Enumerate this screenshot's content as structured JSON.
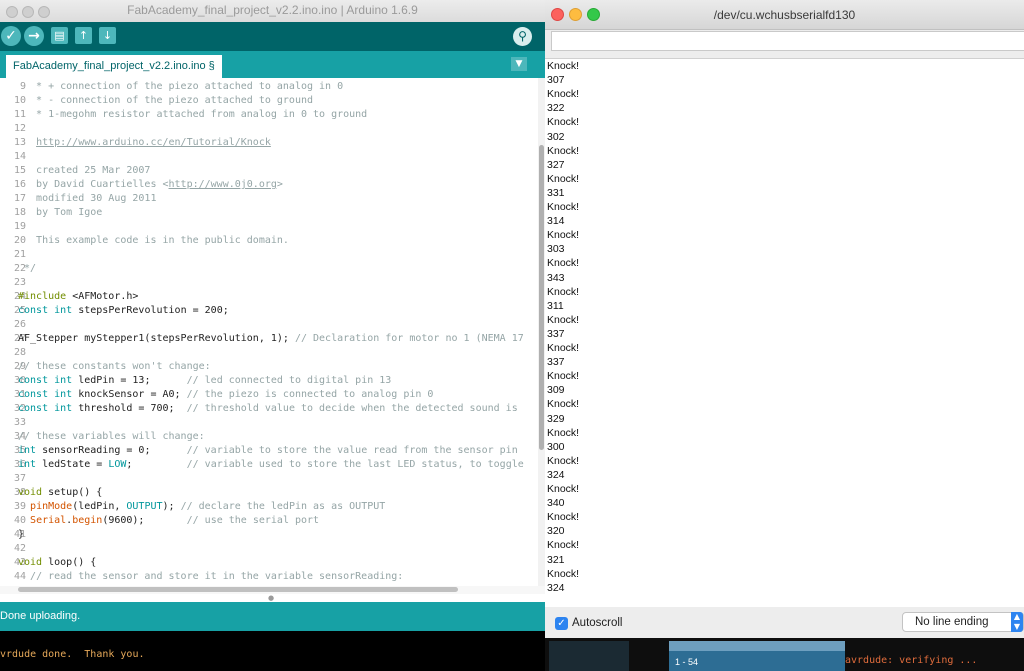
{
  "ide": {
    "title": "FabAcademy_final_project_v2.2.ino.ino | Arduino 1.6.9",
    "tab_label": "FabAcademy_final_project_v2.2.ino.ino §",
    "status": "Done uploading.",
    "console": "vrdude done.  Thank you.",
    "toolbar": {
      "verify": "✓",
      "upload": "→",
      "new": "▤",
      "open": "↑",
      "save": "↓",
      "serial_monitor": "⚲",
      "tab_menu": "▼"
    },
    "code": [
      {
        "n": "9",
        "segs": [
          {
            "t": "   * + connection of the piezo attached to analog in 0",
            "c": "cm"
          }
        ]
      },
      {
        "n": "10",
        "segs": [
          {
            "t": "   * - connection of the piezo attached to ground",
            "c": "cm"
          }
        ]
      },
      {
        "n": "11",
        "segs": [
          {
            "t": "   * 1-megohm resistor attached from analog in 0 to ground",
            "c": "cm"
          }
        ]
      },
      {
        "n": "12",
        "segs": []
      },
      {
        "n": "13",
        "segs": [
          {
            "t": "   ",
            "c": ""
          },
          {
            "t": "http://www.arduino.cc/en/Tutorial/Knock",
            "c": "link"
          }
        ]
      },
      {
        "n": "14",
        "segs": []
      },
      {
        "n": "15",
        "segs": [
          {
            "t": "   created 25 Mar 2007",
            "c": "cm"
          }
        ]
      },
      {
        "n": "16",
        "segs": [
          {
            "t": "   by David Cuartielles <",
            "c": "cm"
          },
          {
            "t": "http://www.0j0.org",
            "c": "link"
          },
          {
            "t": ">",
            "c": "cm"
          }
        ]
      },
      {
        "n": "17",
        "segs": [
          {
            "t": "   modified 30 Aug 2011",
            "c": "cm"
          }
        ]
      },
      {
        "n": "18",
        "segs": [
          {
            "t": "   by Tom Igoe",
            "c": "cm"
          }
        ]
      },
      {
        "n": "19",
        "segs": []
      },
      {
        "n": "20",
        "segs": [
          {
            "t": "   This example code is in the public domain.",
            "c": "cm"
          }
        ]
      },
      {
        "n": "21",
        "segs": []
      },
      {
        "n": "22",
        "segs": [
          {
            "t": " */",
            "c": "cm"
          }
        ]
      },
      {
        "n": "23",
        "segs": []
      },
      {
        "n": "24",
        "segs": [
          {
            "t": "#include ",
            "c": "kw2"
          },
          {
            "t": "<AFMotor.h>",
            "c": ""
          }
        ]
      },
      {
        "n": "25",
        "segs": [
          {
            "t": "const int ",
            "c": "kw"
          },
          {
            "t": "stepsPerRevolution = 200;",
            "c": ""
          }
        ]
      },
      {
        "n": "26",
        "segs": []
      },
      {
        "n": "27",
        "segs": [
          {
            "t": "AF_Stepper myStepper1(stepsPerRevolution, 1); ",
            "c": ""
          },
          {
            "t": "// Declaration for motor no 1 (NEMA 17",
            "c": "cm"
          }
        ]
      },
      {
        "n": "28",
        "segs": []
      },
      {
        "n": "29",
        "segs": [
          {
            "t": "// these constants won't change:",
            "c": "cm"
          }
        ]
      },
      {
        "n": "30",
        "segs": [
          {
            "t": "const int ",
            "c": "kw"
          },
          {
            "t": "ledPin = 13;      ",
            "c": ""
          },
          {
            "t": "// led connected to digital pin 13",
            "c": "cm"
          }
        ]
      },
      {
        "n": "31",
        "segs": [
          {
            "t": "const int ",
            "c": "kw"
          },
          {
            "t": "knockSensor = A0; ",
            "c": ""
          },
          {
            "t": "// the piezo is connected to analog pin 0",
            "c": "cm"
          }
        ]
      },
      {
        "n": "32",
        "segs": [
          {
            "t": "const int ",
            "c": "kw"
          },
          {
            "t": "threshold = 700;  ",
            "c": ""
          },
          {
            "t": "// threshold value to decide when the detected sound is",
            "c": "cm"
          }
        ]
      },
      {
        "n": "33",
        "segs": []
      },
      {
        "n": "34",
        "segs": [
          {
            "t": "// these variables will change:",
            "c": "cm"
          }
        ]
      },
      {
        "n": "35",
        "segs": [
          {
            "t": "int ",
            "c": "kw"
          },
          {
            "t": "sensorReading = 0;      ",
            "c": ""
          },
          {
            "t": "// variable to store the value read from the sensor pin",
            "c": "cm"
          }
        ]
      },
      {
        "n": "36",
        "segs": [
          {
            "t": "int ",
            "c": "kw"
          },
          {
            "t": "ledState = ",
            "c": ""
          },
          {
            "t": "LOW",
            "c": "lit"
          },
          {
            "t": ";         ",
            "c": ""
          },
          {
            "t": "// variable used to store the last LED status, to toggle",
            "c": "cm"
          }
        ]
      },
      {
        "n": "37",
        "segs": []
      },
      {
        "n": "38",
        "segs": [
          {
            "t": "void ",
            "c": "kw2"
          },
          {
            "t": "setup() {",
            "c": ""
          }
        ]
      },
      {
        "n": "39",
        "segs": [
          {
            "t": "  ",
            "c": ""
          },
          {
            "t": "pinMode",
            "c": "fn"
          },
          {
            "t": "(ledPin, ",
            "c": ""
          },
          {
            "t": "OUTPUT",
            "c": "lit"
          },
          {
            "t": "); ",
            "c": ""
          },
          {
            "t": "// declare the ledPin as as OUTPUT",
            "c": "cm"
          }
        ]
      },
      {
        "n": "40",
        "segs": [
          {
            "t": "  ",
            "c": ""
          },
          {
            "t": "Serial",
            "c": "fn"
          },
          {
            "t": ".",
            "c": ""
          },
          {
            "t": "begin",
            "c": "fn"
          },
          {
            "t": "(9600);       ",
            "c": ""
          },
          {
            "t": "// use the serial port",
            "c": "cm"
          }
        ]
      },
      {
        "n": "41",
        "segs": [
          {
            "t": "}",
            "c": ""
          }
        ]
      },
      {
        "n": "42",
        "segs": []
      },
      {
        "n": "43",
        "segs": [
          {
            "t": "void ",
            "c": "kw2"
          },
          {
            "t": "loop() {",
            "c": ""
          }
        ]
      },
      {
        "n": "44",
        "segs": [
          {
            "t": "  ",
            "c": ""
          },
          {
            "t": "// read the sensor and store it in the variable sensorReading:",
            "c": "cm"
          }
        ]
      }
    ]
  },
  "serial": {
    "title": "/dev/cu.wchusbserialfd130",
    "send_value": "",
    "lines": [
      "Knock!",
      "307",
      "Knock!",
      "322",
      "Knock!",
      "302",
      "Knock!",
      "327",
      "Knock!",
      "331",
      "Knock!",
      "314",
      "Knock!",
      "303",
      "Knock!",
      "343",
      "Knock!",
      "311",
      "Knock!",
      "337",
      "Knock!",
      "337",
      "Knock!",
      "309",
      "Knock!",
      "329",
      "Knock!",
      "300",
      "Knock!",
      "324",
      "Knock!",
      "340",
      "Knock!",
      "320",
      "Knock!",
      "321",
      "Knock!",
      "324"
    ],
    "autoscroll_label": "Autoscroll",
    "autoscroll_checked": true,
    "line_ending": "No line ending"
  },
  "background": {
    "count_label": "1 - 54",
    "avr_text": "avrdude: verifying ..."
  },
  "colors": {
    "arduino_dark": "#006468",
    "arduino_teal": "#17a1a5",
    "mac_red": "#fc615d",
    "mac_yellow": "#fdbc40",
    "mac_green": "#34c84a",
    "mac_blue": "#2d84f0"
  }
}
